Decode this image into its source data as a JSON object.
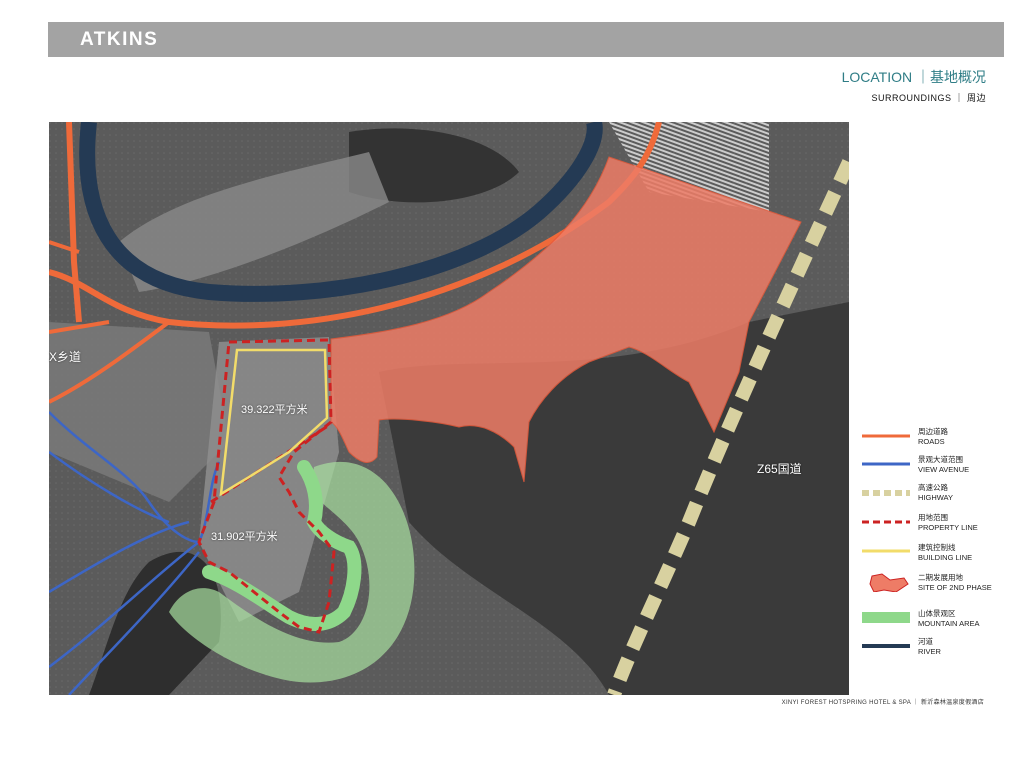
{
  "header": {
    "logo": "ATKINS"
  },
  "title": {
    "location": "LOCATION ｜基地概况",
    "subtitle": "SURROUNDINGS ｜ 周边"
  },
  "map": {
    "labels": {
      "village_road": "X乡道",
      "area_1": "39.322平方米",
      "area_2": "31.902平方米",
      "national_road": "Z65国道"
    }
  },
  "legend": {
    "items": [
      {
        "cn": "周边道路",
        "en": "ROADS",
        "icon": "orange-line",
        "color": "#ef6a3a"
      },
      {
        "cn": "景观大道范围",
        "en": "VIEW AVENUE",
        "icon": "blue-line",
        "color": "#3d66c6"
      },
      {
        "cn": "高速公路",
        "en": "HIGHWAY",
        "icon": "dashed-khaki-line",
        "color": "#d8d1a0"
      },
      {
        "cn": "用地范围",
        "en": "PROPERTY LINE",
        "icon": "dashed-red-line",
        "color": "#cc2222"
      },
      {
        "cn": "建筑控制线",
        "en": "BUILDING LINE",
        "icon": "yellow-line",
        "color": "#f2dc6a"
      },
      {
        "cn": "二期发展用地",
        "en": "SITE OF 2ND PHASE",
        "icon": "red-polygon",
        "color": "#ee7c66"
      },
      {
        "cn": "山体景观区",
        "en": "MOUNTAIN AREA",
        "icon": "green-bar",
        "color": "#8ed88a"
      },
      {
        "cn": "河道",
        "en": "RIVER",
        "icon": "navy-line",
        "color": "#243a54"
      }
    ]
  },
  "footer": {
    "text": "XINYI FOREST HOTSPRING HOTEL & SPA ｜ 新沂森林温泉度假酒店"
  }
}
